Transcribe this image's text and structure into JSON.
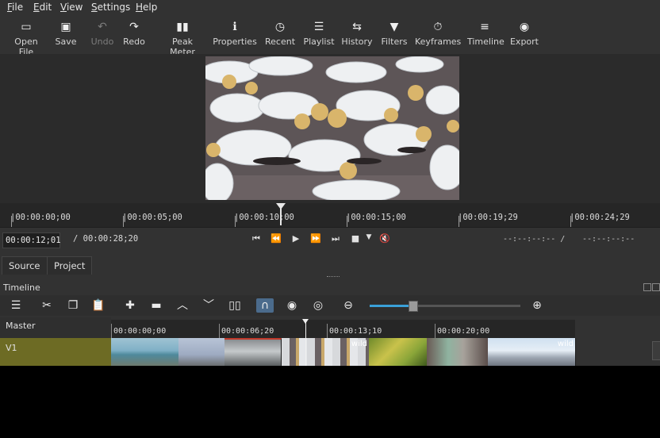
{
  "menubar": {
    "items": [
      {
        "label": "File",
        "key": "F",
        "rest": "ile"
      },
      {
        "label": "Edit",
        "key": "E",
        "rest": "dit"
      },
      {
        "label": "View",
        "key": "V",
        "rest": "iew"
      },
      {
        "label": "Settings",
        "key": "S",
        "rest": "ettings"
      },
      {
        "label": "Help",
        "key": "H",
        "rest": "elp"
      }
    ]
  },
  "toolbar": {
    "open_file": "Open File",
    "save": "Save",
    "undo": "Undo",
    "redo": "Redo",
    "peak_meter": "Peak Meter",
    "properties": "Properties",
    "recent": "Recent",
    "playlist": "Playlist",
    "history": "History",
    "filters": "Filters",
    "keyframes": "Keyframes",
    "timeline": "Timeline",
    "export": "Export"
  },
  "ruler": {
    "labels": [
      "|00:00:00;00",
      "|00:00:05;00",
      "|00:00:10;00",
      "|00:00:15;00",
      "|00:00:19;29",
      "|00:00:24;29"
    ]
  },
  "transport": {
    "current_timecode": "00:00:12;01",
    "total_duration": "/ 00:00:28;20",
    "in_point": "--:--:--:-- /",
    "out_point": "--:--:--:--"
  },
  "tabs": {
    "source": "Source",
    "project": "Project"
  },
  "timeline": {
    "title": "Timeline",
    "master_label": "Master",
    "v1_label": "V1",
    "ruler_labels": [
      "00:00:00;00",
      "00:00:06;20",
      "00:00:13;10",
      "00:00:20;00"
    ],
    "zoom_level": 0.3,
    "clips": [
      {
        "caption": ""
      },
      {
        "caption": ""
      },
      {
        "caption": ""
      },
      {
        "caption": "wild"
      },
      {
        "caption": ""
      },
      {
        "caption": ""
      },
      {
        "caption": "wild"
      }
    ]
  },
  "colors": {
    "v1_track_header": "#6d6b24",
    "active_tool": "#4b6b8c",
    "zoom_accent": "#3aa0d8"
  }
}
